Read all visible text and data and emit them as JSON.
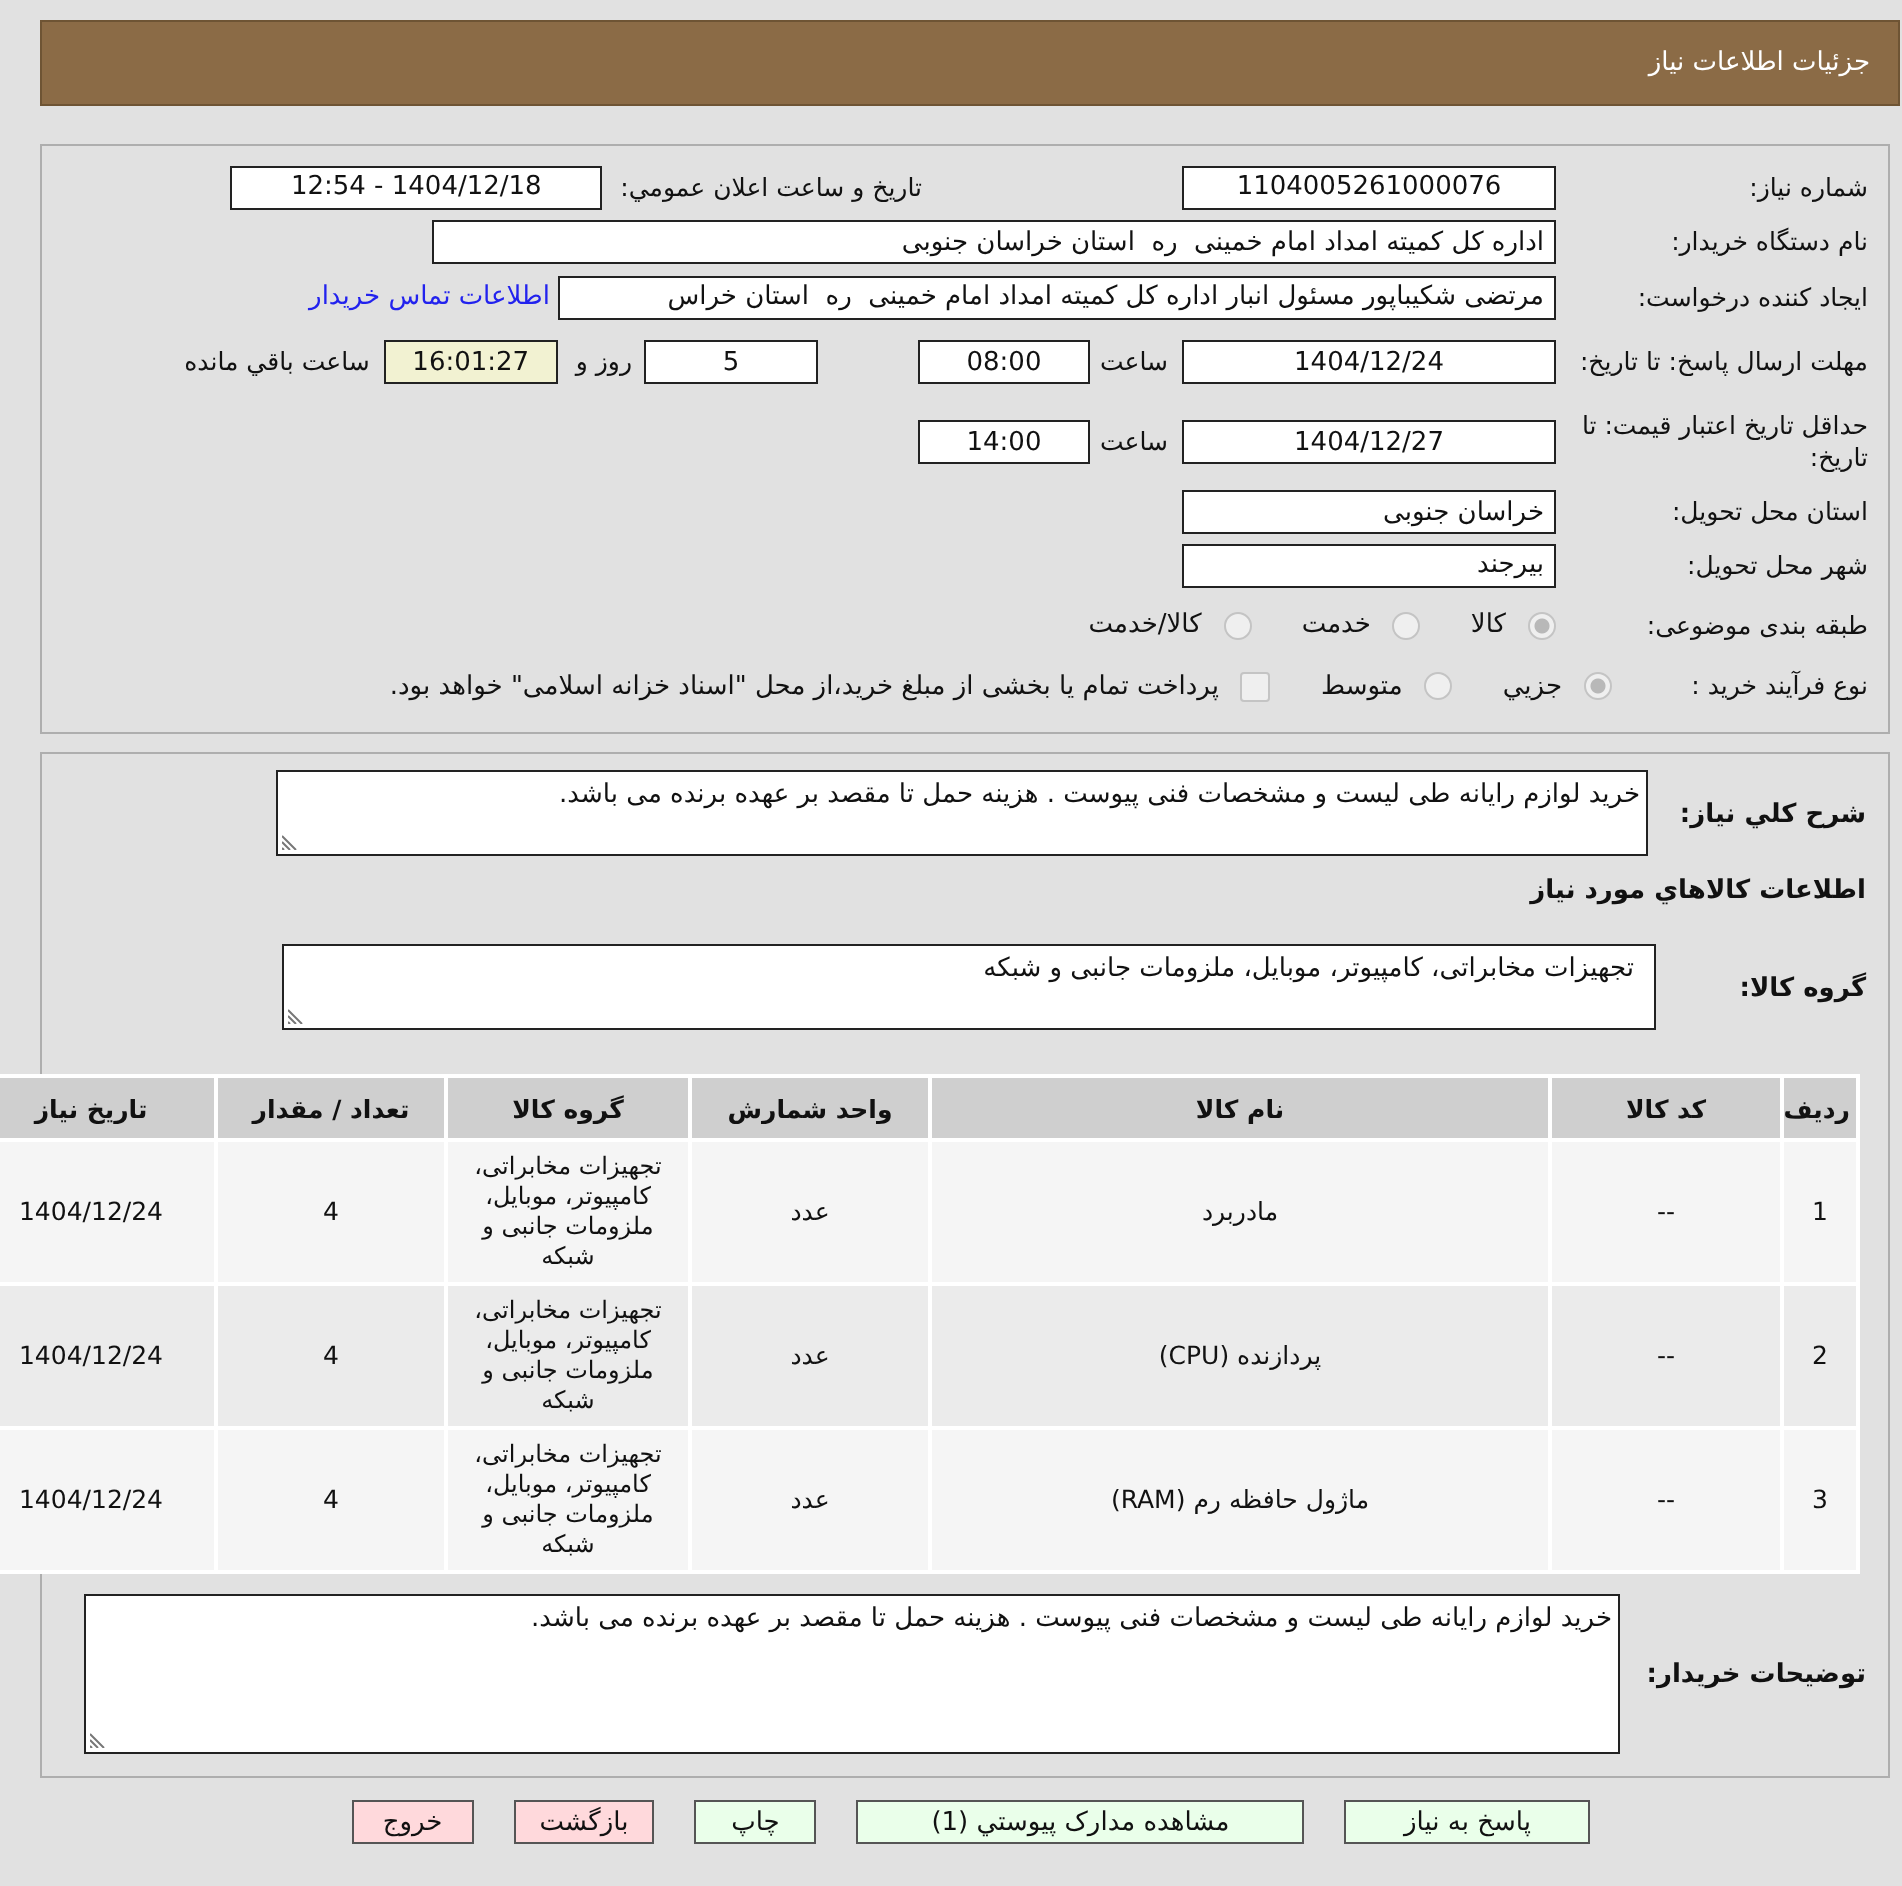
{
  "header": {
    "title": "جزئیات اطلاعات نیاز"
  },
  "details": {
    "need_number": {
      "label": "شماره نیاز:",
      "value": "1104005261000076"
    },
    "announcement": {
      "label": "تاريخ و ساعت اعلان عمومي:",
      "value": "1404/12/18 - 12:54"
    },
    "buyer_organization": {
      "label": "نام دستگاه خريدار:",
      "value": "اداره کل کمیته امداد امام خمینی  ره  استان خراسان جنوبی"
    },
    "requester": {
      "label": "ایجاد کننده درخواست:",
      "value": "مرتضی شکیباپور مسئول انبار اداره کل کمیته امداد امام خمینی  ره  استان خراس",
      "contact_link": "اطلاعات تماس خريدار"
    },
    "response_deadline": {
      "label": "مهلت ارسال پاسخ: تا تاریخ:",
      "date": "1404/12/24",
      "time_label": "ساعت",
      "time": "08:00",
      "days": "5",
      "days_label": "روز و",
      "remaining": "16:01:27",
      "remaining_label": "ساعت باقي مانده"
    },
    "price_validity": {
      "label": "حداقل تاریخ اعتبار قیمت: تا تاریخ:",
      "date": "1404/12/27",
      "time_label": "ساعت",
      "time": "14:00"
    },
    "delivery_province": {
      "label": "استان محل تحویل:",
      "value": "خراسان جنوبی"
    },
    "delivery_city": {
      "label": "شهر محل تحویل:",
      "value": "بیرجند"
    },
    "subject_category": {
      "label": "طبقه بندی موضوعی:",
      "options": [
        {
          "label": "کالا",
          "selected": true
        },
        {
          "label": "خدمت",
          "selected": false
        },
        {
          "label": "کالا/خدمت",
          "selected": false
        }
      ]
    },
    "purchase_process": {
      "label": "نوع فرآیند خرید :",
      "options": [
        {
          "label": "جزيي",
          "selected": true
        },
        {
          "label": "متوسط",
          "selected": false
        }
      ],
      "treasury_payment": {
        "label": "پرداخت تمام یا بخشی از مبلغ خرید،از محل \"اسناد خزانه اسلامی\" خواهد بود.",
        "checked": false
      }
    }
  },
  "needs": {
    "summary": {
      "label": "شرح کلي نياز:",
      "value": "خرید لوازم رایانه طی لیست و مشخصات فنی پیوست . هزینه حمل تا مقصد بر عهده برنده می باشد."
    },
    "goods_title": "اطلاعات کالاهاي مورد نياز",
    "goods_group": {
      "label": "گروه کالا:",
      "value": "تجهیزات مخابراتی، کامپیوتر، موبایل، ملزومات جانبی و شبکه"
    },
    "table": {
      "columns": [
        "ردیف",
        "کد کالا",
        "نام کالا",
        "واحد شمارش",
        "گروه کالا",
        "تعداد / مقدار",
        "تاریخ نیاز"
      ],
      "rows": [
        [
          "1",
          "--",
          "مادربرد",
          "عدد",
          "تجهیزات مخابراتی، کامپیوتر، موبایل، ملزومات جانبی و شبکه",
          "4",
          "1404/12/24"
        ],
        [
          "2",
          "--",
          "پردازنده (CPU)",
          "عدد",
          "تجهیزات مخابراتی، کامپیوتر، موبایل، ملزومات جانبی و شبکه",
          "4",
          "1404/12/24"
        ],
        [
          "3",
          "--",
          "ماژول حافظه رم (RAM)",
          "عدد",
          "تجهیزات مخابراتی، کامپیوتر، موبایل، ملزومات جانبی و شبکه",
          "4",
          "1404/12/24"
        ]
      ]
    },
    "buyer_notes": {
      "label": "توضیحات خریدار:",
      "value": "خرید لوازم رایانه طی لیست و مشخصات فنی پیوست . هزینه حمل تا مقصد بر عهده برنده می باشد."
    }
  },
  "buttons": [
    {
      "label": "پاسخ به نیاز",
      "kind": "confirm"
    },
    {
      "label": "مشاهده مدارک پیوستي (1)",
      "kind": "confirm"
    },
    {
      "label": "چاپ",
      "kind": "confirm"
    },
    {
      "label": "بازگشت",
      "kind": "cancel"
    },
    {
      "label": "خروج",
      "kind": "cancel"
    }
  ]
}
